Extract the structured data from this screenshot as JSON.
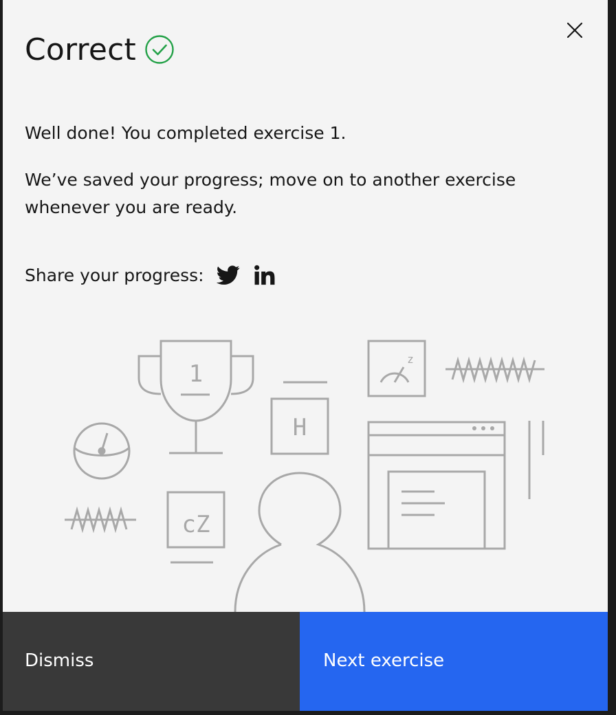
{
  "modal": {
    "title": "Correct",
    "close_label": "Close",
    "message_primary": "Well done! You completed exercise 1.",
    "message_secondary": "We’ve saved your progress; move on to another exercise whenever you are ready.",
    "share_label": "Share your progress:",
    "share_icons": [
      "twitter-icon",
      "linkedin-icon"
    ],
    "illustration": {
      "trophy_number": "1",
      "tile_h": "H",
      "tile_cz": "cZ",
      "gauge_letter": "z"
    },
    "buttons": {
      "dismiss_label": "Dismiss",
      "next_label": "Next exercise"
    }
  },
  "colors": {
    "modal_bg": "#f4f4f4",
    "success": "#42be65",
    "primary": "#2566f0",
    "secondary": "#393939",
    "illustration_stroke": "#a8a8a8"
  }
}
